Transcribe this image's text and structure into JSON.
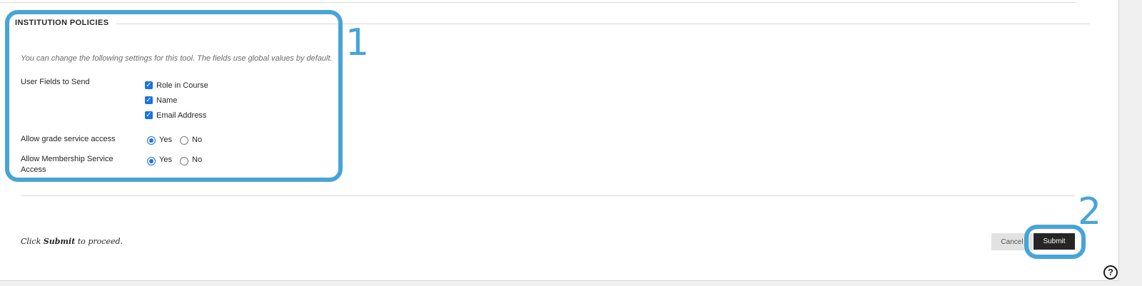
{
  "section": {
    "title": "INSTITUTION POLICIES",
    "intro": "You can change the following settings for this tool. The fields use global values by default."
  },
  "user_fields": {
    "label": "User Fields to Send",
    "options": [
      {
        "label": "Role in Course",
        "checked": true
      },
      {
        "label": "Name",
        "checked": true
      },
      {
        "label": "Email Address",
        "checked": true
      }
    ]
  },
  "grade_service": {
    "label": "Allow grade service access",
    "yes": "Yes",
    "no": "No",
    "selected": "Yes"
  },
  "membership_service": {
    "label_line1": "Allow Membership Service",
    "label_line2": "Access",
    "yes": "Yes",
    "no": "No",
    "selected": "Yes"
  },
  "footer": {
    "prefix": "Click ",
    "bold": "Submit",
    "suffix": " to proceed."
  },
  "buttons": {
    "cancel": "Cancel",
    "submit": "Submit"
  },
  "callouts": {
    "one": "1",
    "two": "2",
    "color": "#47a4d7"
  },
  "help": {
    "glyph": "?"
  },
  "icons": {
    "checkbox": "checkmark-icon",
    "help": "question-circle-icon"
  }
}
